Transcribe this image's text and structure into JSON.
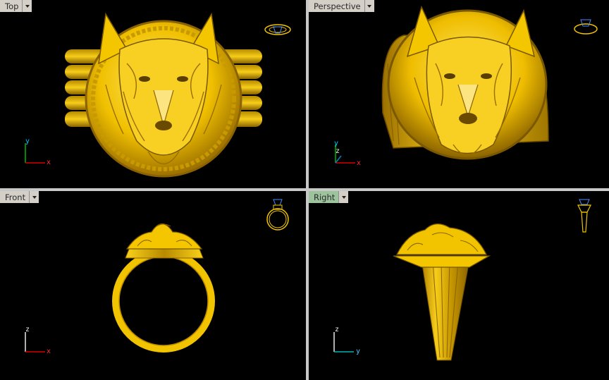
{
  "viewports": {
    "top": {
      "label": "Top",
      "active": false,
      "axis_v": "y",
      "axis_h": "x"
    },
    "perspective": {
      "label": "Perspective",
      "active": false,
      "axis_v": "y",
      "axis_z": "z",
      "axis_h": "x"
    },
    "front": {
      "label": "Front",
      "active": false,
      "axis_v": "z",
      "axis_h": "x"
    },
    "right": {
      "label": "Right",
      "active": true,
      "axis_v": "z",
      "axis_h": "y"
    }
  },
  "colors": {
    "viewport_bg": "#000000",
    "frame": "#c8c8c8",
    "gold": "#f2c400",
    "gold_dark": "#a57a00",
    "gold_light": "#ffe766",
    "axis_red": "#d40000",
    "axis_green": "#00b300",
    "axis_blue": "#0080c0",
    "axis_z": "#e8e8e8",
    "active_tab": "#9cc39c"
  }
}
